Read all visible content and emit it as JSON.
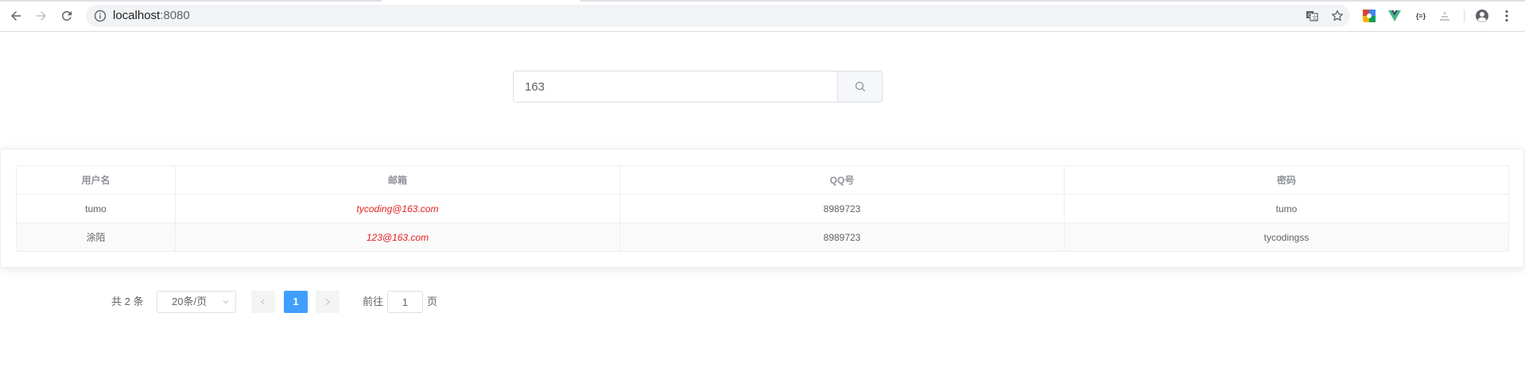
{
  "browser": {
    "url_host": "localhost",
    "url_port": ":8080",
    "icons": [
      "back-icon",
      "forward-icon",
      "reload-icon",
      "info-icon",
      "translate-icon",
      "star-icon",
      "extension-color-icon",
      "vue-devtools-icon",
      "json-icon",
      "extension-grey-icon",
      "profile-icon",
      "menu-icon"
    ],
    "json_ext_label": "{≡}"
  },
  "search": {
    "value": "163"
  },
  "table": {
    "columns": [
      "用户名",
      "邮箱",
      "QQ号",
      "密码"
    ],
    "rows": [
      {
        "username": "tumo",
        "email": "tycoding@163.com",
        "qq": "8989723",
        "password": "tumo"
      },
      {
        "username": "涂陌",
        "email": "123@163.com",
        "qq": "8989723",
        "password": "tycodingss"
      }
    ]
  },
  "pagination": {
    "total": "共 2 条",
    "page_size": "20条/页",
    "current_page": "1",
    "goto_prefix": "前往",
    "goto_value": "1",
    "goto_suffix": "页"
  },
  "colors": {
    "primary": "#409eff",
    "email_text": "#e61e1e",
    "vue_green": "#41b883"
  }
}
